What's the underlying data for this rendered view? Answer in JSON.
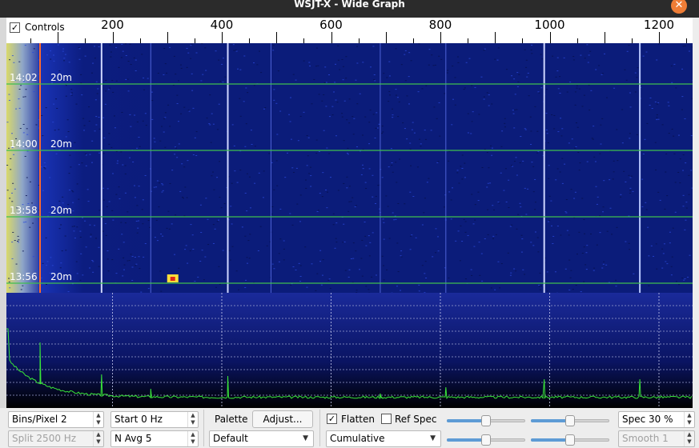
{
  "window": {
    "title": "WSJT-X - Wide Graph"
  },
  "ruler": {
    "controls_checked": true,
    "controls_label": "Controls",
    "freq_labels": [
      "200",
      "400",
      "600",
      "800",
      "1000",
      "1200"
    ]
  },
  "waterfall": {
    "rows": [
      {
        "time": "14:02",
        "band": "20m"
      },
      {
        "time": "14:00",
        "band": "20m"
      },
      {
        "time": "13:58",
        "band": "20m"
      },
      {
        "time": "13:56",
        "band": "20m"
      }
    ]
  },
  "controls": {
    "bins_per_pixel": "Bins/Pixel  2",
    "split": "Split  2500  Hz",
    "start": "Start 0 Hz",
    "n_avg": "N Avg 5",
    "palette_label": "Palette",
    "adjust_button": "Adjust...",
    "palette_value": "Default",
    "flatten_checked": true,
    "flatten_label": "Flatten",
    "ref_spec_checked": false,
    "ref_spec_label": "Ref Spec",
    "spectrum_mode": "Cumulative",
    "spec_percent": "Spec 30 %",
    "smooth": "Smooth  1"
  },
  "sliders": {
    "top_left_level": 0.5,
    "top_right_level": 0.5,
    "bottom_left_level": 0.5,
    "bottom_right_level": 0.5
  },
  "colors": {
    "waterfall_bg": "#0b1c7a",
    "trace": "#39e639",
    "marker": "#ff6a2b",
    "titlebar": "#2b2b2b",
    "close_button": "#ef7d36"
  }
}
